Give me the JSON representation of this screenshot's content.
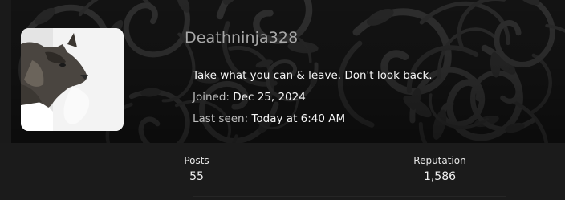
{
  "profile": {
    "username": "Deathninja328",
    "status_message": "Take what you can & leave. Don't look back.",
    "joined_label": "Joined:",
    "joined_value": "Dec 25, 2024",
    "last_seen_label": "Last seen:",
    "last_seen_value": "Today at 6:40 AM"
  },
  "stats": {
    "posts_label": "Posts",
    "posts_value": "55",
    "reputation_label": "Reputation",
    "reputation_value": "1,586"
  },
  "colors": {
    "banner_background": "#141414",
    "stats_background": "#1b1b1b",
    "username_color": "#a8a8a8",
    "text_color": "#f0f0f0"
  },
  "icons": {
    "avatar": "cat-photo-avatar"
  }
}
